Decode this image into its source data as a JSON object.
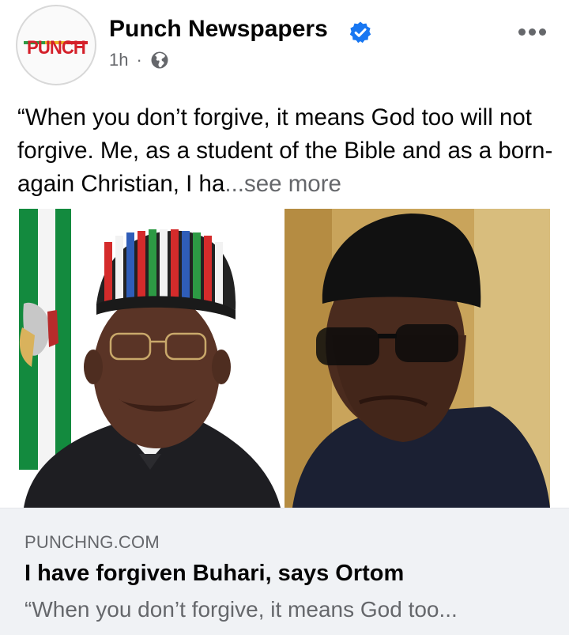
{
  "post": {
    "page_name": "Punch Newspapers",
    "avatar_logo_text": "PUNCH",
    "time": "1h",
    "separator": "·",
    "audience_icon": "globe-icon",
    "verified_icon": "verified-badge-icon",
    "more_icon": "more-options-icon",
    "caption_text": "“When you don’t forgive, it means God too will not forgive. Me, as a student of the Bible and as a born-again Christian, I ha",
    "see_more": "...see more"
  },
  "link_preview": {
    "domain": "PUNCHNG.COM",
    "headline": "I have forgiven Buhari, says Ortom",
    "description": "“When you don’t forgive, it means God too..."
  },
  "colors": {
    "verified_blue": "#1877f2",
    "punch_red": "#d4202a",
    "secondary_text": "#65676b",
    "link_bg": "#f0f2f5"
  }
}
